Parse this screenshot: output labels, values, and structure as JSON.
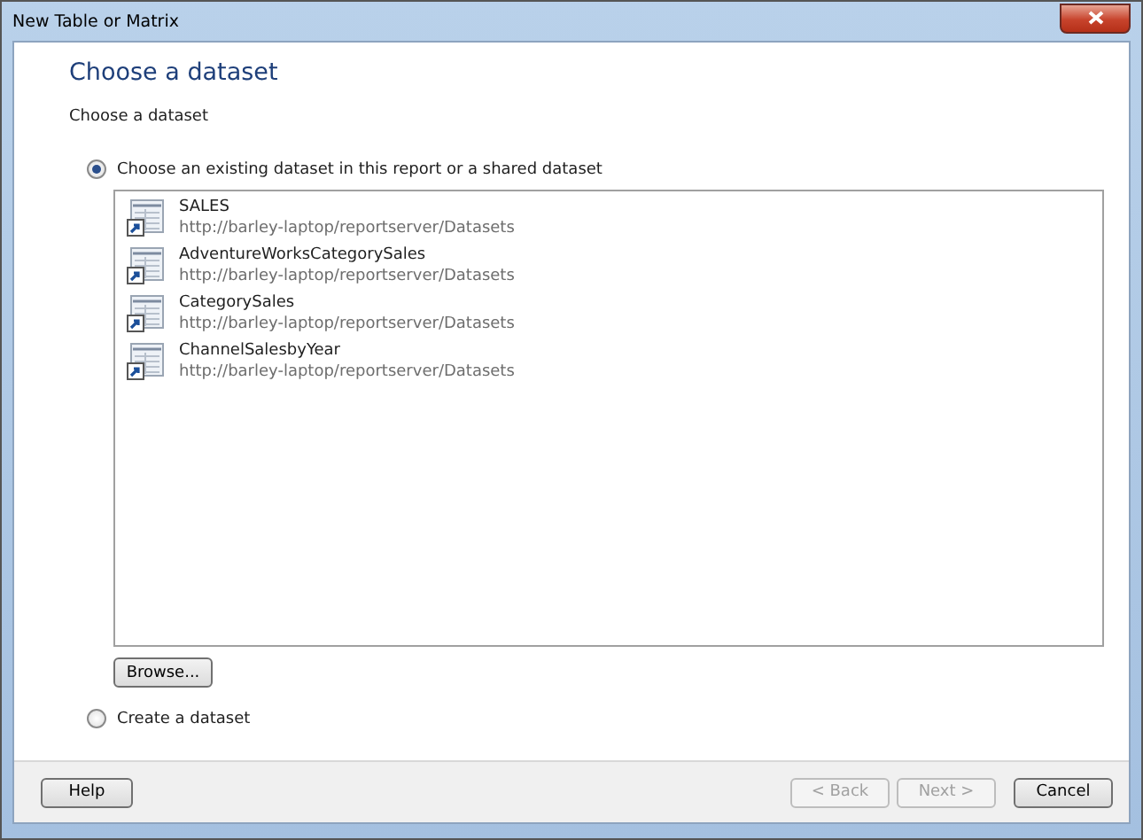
{
  "window": {
    "title": "New Table or Matrix"
  },
  "page_title": "Choose a dataset",
  "section_label": "Choose a dataset",
  "options": [
    {
      "kind": "existing",
      "label": "Choose an existing dataset in this report or a shared dataset",
      "selected": true
    },
    {
      "kind": "create",
      "label": "Create a dataset",
      "selected": false
    }
  ],
  "datasets": [
    {
      "name": "SALES",
      "path": "http://barley-laptop/reportserver/Datasets"
    },
    {
      "name": "AdventureWorksCategorySales",
      "path": "http://barley-laptop/reportserver/Datasets"
    },
    {
      "name": "CategorySales",
      "path": "http://barley-laptop/reportserver/Datasets"
    },
    {
      "name": "ChannelSalesbyYear",
      "path": "http://barley-laptop/reportserver/Datasets"
    }
  ],
  "browse_button": {
    "label": "Browse..."
  },
  "left_buttons": [
    {
      "label": "Help",
      "disabled": false
    }
  ],
  "right_buttons": [
    {
      "label": "< Back",
      "disabled": true
    },
    {
      "label": "Next >",
      "disabled": true
    },
    {
      "label": "Cancel",
      "disabled": false
    }
  ]
}
